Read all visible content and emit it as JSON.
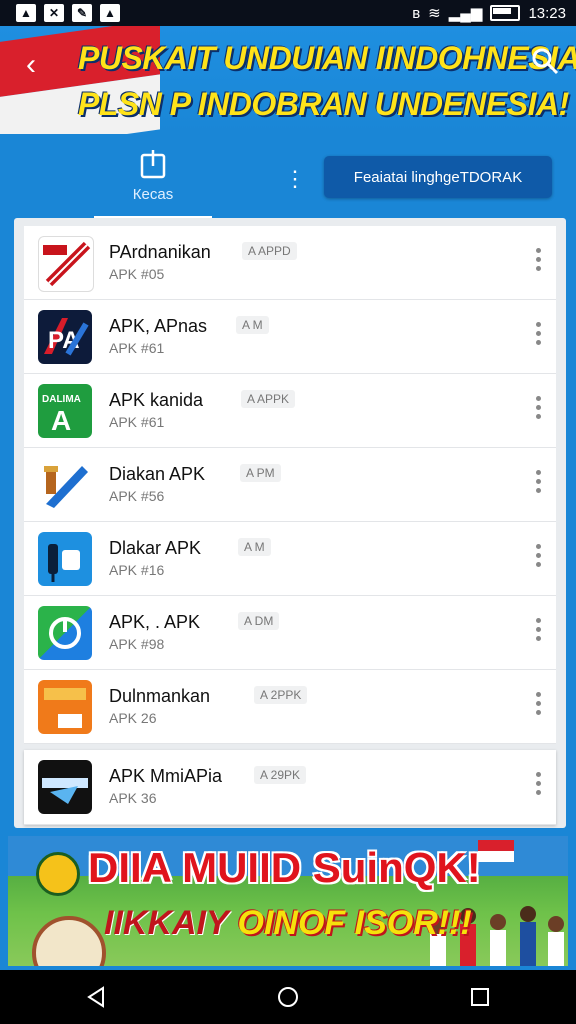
{
  "status": {
    "time": "13:23"
  },
  "header": {
    "title_line1": "PUSKAIT UNDUIAN IINDOHNESIA",
    "title_line2": "PLSN P INDOBRAN UNDENESIA!"
  },
  "tabs": {
    "recent_label": "Кecas",
    "feature_button": "Feaiatai linghgeTDORAK"
  },
  "apps": [
    {
      "name": "PArdnanikan",
      "tag": "A APPD",
      "sub": "APK #05",
      "icon": "red-pen-icon"
    },
    {
      "name": "APK, APnas",
      "tag": "A M",
      "sub": "APK #61",
      "icon": "pa-logo-icon"
    },
    {
      "name": "APK kanida",
      "tag": "A APPK",
      "sub": "APK #61",
      "icon": "dalima-a-icon"
    },
    {
      "name": "Diakan APK",
      "tag": "A PM",
      "sub": "APK #56",
      "icon": "torch-ribbon-icon"
    },
    {
      "name": "Dlakar APK",
      "tag": "A M",
      "sub": "APK #16",
      "icon": "usb-device-icon"
    },
    {
      "name": "APK, . APK",
      "tag": "A DM",
      "sub": "APK #98",
      "icon": "power-circle-icon"
    },
    {
      "name": "Dulnmankan",
      "tag": "A 2PPK",
      "sub": "APK 26",
      "icon": "orange-box-icon"
    },
    {
      "name": "APK MmiAPia",
      "tag": "A 29PK",
      "sub": "APK 36",
      "icon": "dark-bird-icon"
    }
  ],
  "banner": {
    "line1": "DIIA  MUIID  SuinQK!",
    "line2_a": "IIKKAIY ",
    "line2_b": "OINOF ISOR!!!"
  },
  "colors": {
    "header_bg": "#1a86d6",
    "title_yellow": "#ffe31a",
    "button_blue": "#0f5aa8"
  }
}
